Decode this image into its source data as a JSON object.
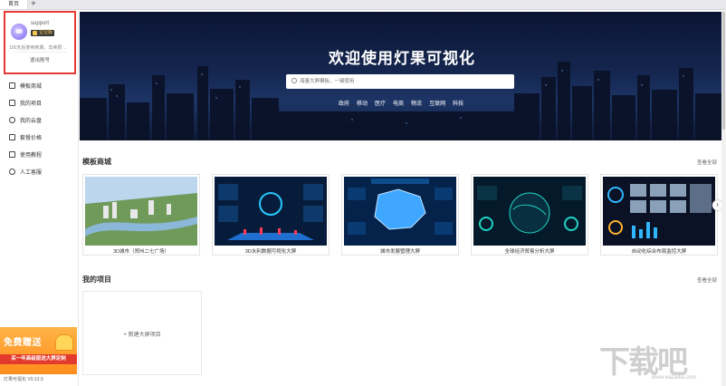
{
  "tabs": {
    "home_label": "首页",
    "add_label": "+"
  },
  "user": {
    "name": "support",
    "badge": "企业版",
    "expiry_note": "150天后使用到期，去续费→",
    "logout_label": "退出账号"
  },
  "nav": {
    "items": [
      {
        "label": "模板商城",
        "icon": "template-icon"
      },
      {
        "label": "我的项目",
        "icon": "project-icon"
      },
      {
        "label": "我的云盘",
        "icon": "cloud-icon"
      },
      {
        "label": "套餐价格",
        "icon": "tag-icon"
      },
      {
        "label": "使用教程",
        "icon": "tutorial-icon"
      },
      {
        "label": "人工客服",
        "icon": "person-icon"
      }
    ]
  },
  "promo": {
    "title": "免费赠送",
    "subtitle": "买一年高级版送大屏定制"
  },
  "version": "灯果可视化 V0.13.9",
  "hero": {
    "title": "欢迎使用灯果可视化",
    "search_placeholder": "海量大屏模板，一键使用",
    "hot_tags": [
      "政府",
      "移动",
      "医疗",
      "电商",
      "物流",
      "互联网",
      "科技"
    ]
  },
  "templates": {
    "title": "模板商城",
    "see_all": "查看全部",
    "cards": [
      {
        "label": "3D城市（郑州二七广场）"
      },
      {
        "label": "3D水利数据可视化大屏"
      },
      {
        "label": "城市发展管理大屏"
      },
      {
        "label": "全球经济贸易分析大屏"
      },
      {
        "label": "自动化综合布局监控大屏"
      }
    ],
    "next_label": "›"
  },
  "projects": {
    "title": "我的项目",
    "see_all": "查看全部",
    "new_label": "+ 新建大屏项目"
  },
  "watermark": {
    "text": "下载吧",
    "url": "www.xiazaiba.com"
  },
  "colors": {
    "highlight": "#e53935",
    "hero_bg": "#14254e",
    "accent": "#1e90ff"
  }
}
